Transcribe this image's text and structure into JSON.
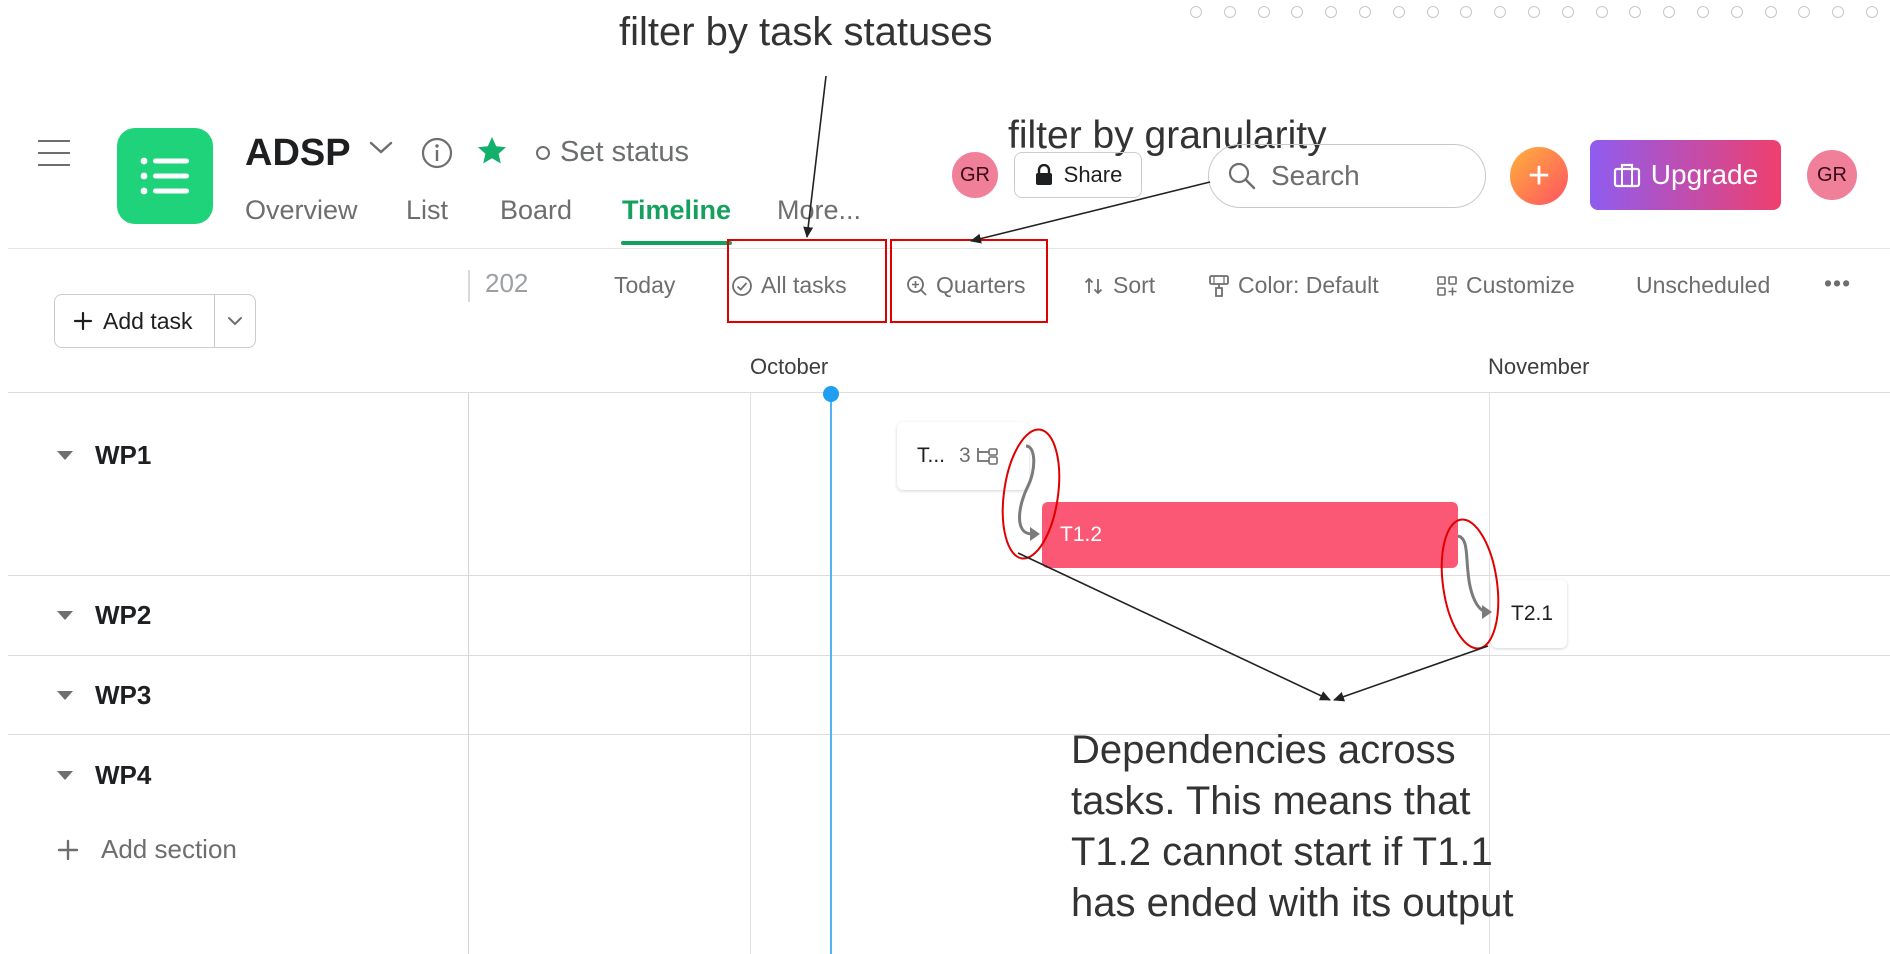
{
  "annotations": {
    "top_label": "filter by task statuses",
    "granularity_label": "filter by granularity",
    "dependencies_lines": [
      "Dependencies across",
      "tasks. This means that",
      "T1.2 cannot start if T1.1",
      "has ended with its output"
    ]
  },
  "header": {
    "project_name": "ADSP",
    "set_status": "Set status",
    "tabs": [
      "Overview",
      "List",
      "Board",
      "Timeline",
      "More..."
    ],
    "active_tab": "Timeline",
    "avatar_initials": "GR",
    "share_label": "Share",
    "search_placeholder": "Search",
    "upgrade_label": "Upgrade",
    "plus_symbol": "+"
  },
  "toolbar": {
    "add_task_label": "Add task",
    "year_fragment": "202",
    "today_label": "Today",
    "all_tasks_label": "All tasks",
    "quarters_label": "Quarters",
    "sort_label": "Sort",
    "color_label": "Color: Default",
    "customize_label": "Customize",
    "unscheduled_label": "Unscheduled",
    "more_label": "•••"
  },
  "timeline": {
    "months": [
      "October",
      "November"
    ],
    "sections": [
      "WP1",
      "WP2",
      "WP3",
      "WP4"
    ],
    "add_section_label": "Add section",
    "tasks": {
      "t11_label": "T...",
      "t11_subtasks": "3",
      "t12_label": "T1.2",
      "t21_label": "T2.1"
    },
    "colors": {
      "accent_green": "#16a05d",
      "task_red": "#fa5874",
      "today_blue": "#1f9ff2",
      "annotation_red": "#e00000"
    }
  }
}
